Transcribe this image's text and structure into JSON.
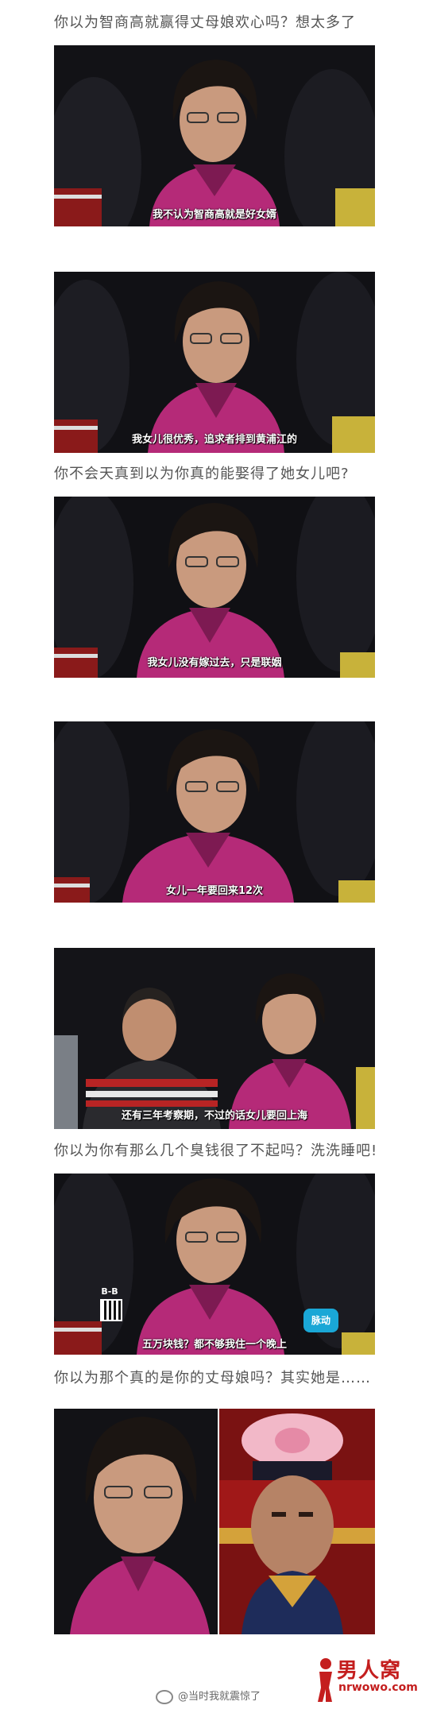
{
  "captions": [
    "你以为智商高就赢得丈母娘欢心吗？想太多了",
    "你不会天真到以为你真的能娶得了她女儿吧?",
    "你以为你有那么几个臭钱很了不起吗？洗洗睡吧!",
    "你以为那个真的是你的丈母娘吗？其实她是……"
  ],
  "subtitles": [
    "我不认为智商高就是好女婿",
    "我女儿很优秀，追求者排到黄浦江的",
    "我女儿没有嫁过去，只是联姻",
    "女儿一年要回来12次",
    "还有三年考察期，不过的话女儿要回上海",
    "五万块钱？都不够我住一个晚上"
  ],
  "logos": {
    "bb_text": "B-B",
    "channel_text": "脉动"
  },
  "footer": {
    "weibo_handle": "@当时我就震惊了",
    "brand_name": "男人窝",
    "brand_url": "nrwowo.com"
  },
  "colors": {
    "shirt": "#b52a78",
    "shirt_shadow": "#7d1a52",
    "hair": "#1b1512",
    "skin": "#c99a7e",
    "stage_bg": "#0e0e12",
    "brand_red": "#c41e1e"
  }
}
